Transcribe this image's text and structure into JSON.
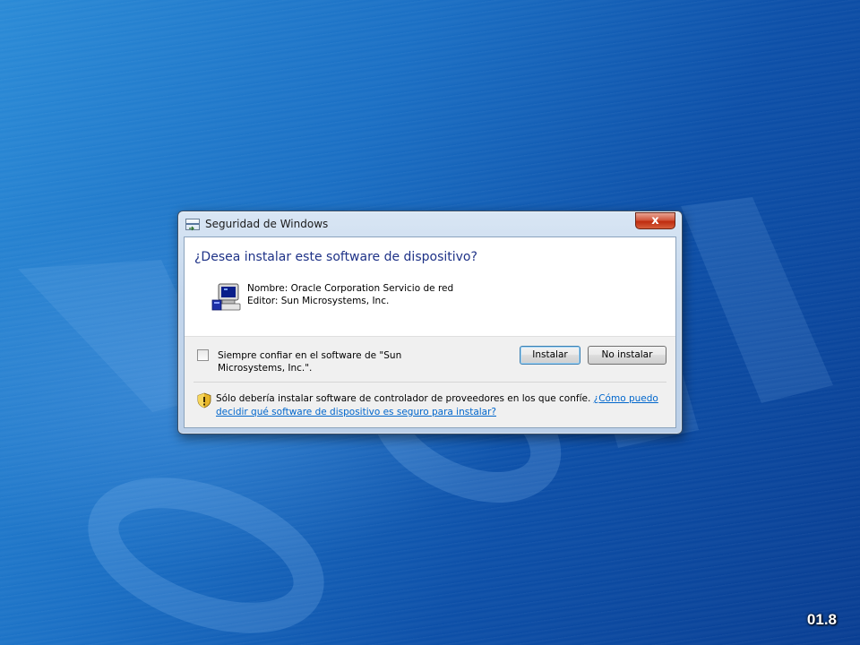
{
  "window": {
    "title": "Seguridad de Windows",
    "close_label": "x"
  },
  "dialog": {
    "heading": "¿Desea instalar este software de dispositivo?",
    "name_line": "Nombre: Oracle Corporation Servicio de red",
    "publisher_line": "Editor: Sun Microsystems, Inc.",
    "always_trust_label": "Siempre confiar en el software de \"Sun Microsystems, Inc.\".",
    "always_trust_checked": false,
    "install_button": "Instalar",
    "dont_install_button": "No instalar",
    "warning_text": "Sólo debería instalar software de controlador de proveedores en los que confíe.",
    "help_link": "¿Cómo puedo decidir qué software de dispositivo es seguro para instalar?"
  },
  "desktop": {
    "build_tag": "01.8"
  },
  "colors": {
    "heading": "#1e3287",
    "link": "#0066cc",
    "close_button": "#c8391b",
    "desktop_dark": "#083d92",
    "desktop_light": "#2a8ad6"
  },
  "icons": {
    "title": "window-app-icon",
    "device": "computer-device-icon",
    "warning": "security-shield-icon"
  }
}
